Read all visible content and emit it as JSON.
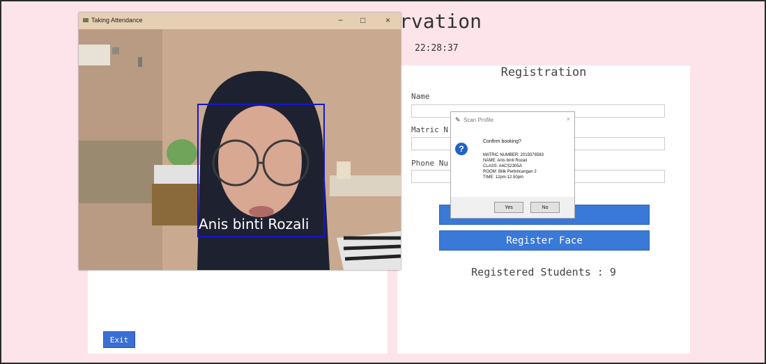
{
  "app": {
    "title_fragment": "rvation",
    "time": "22:28:37"
  },
  "left_panel": {
    "exit_label": "Exit"
  },
  "registration": {
    "title": "Registration",
    "fields": [
      {
        "label": "Name",
        "value": ""
      },
      {
        "label": "Matric N",
        "value": ""
      },
      {
        "label": "Phone Nu",
        "value": ""
      }
    ],
    "buttons": [
      "",
      "Register Face"
    ],
    "registered_count_text": "Registered Students : 9"
  },
  "camera_window": {
    "title": "Taking Attendance",
    "minimize": "−",
    "maximize": "□",
    "close": "×",
    "recognized_name": "Anis binti Rozali"
  },
  "dialog": {
    "title": "Scan Profile",
    "message": "Confirm booking?",
    "lines": [
      "MATRIC NUMBER: 2019376583",
      "NAME: Anis binti Rozali",
      "CLASS: A4CS2305A",
      "ROOM: Bilik Perbincangan 2",
      "TIME: 12pm-12.50pm"
    ],
    "yes_label": "Yes",
    "no_label": "No"
  }
}
